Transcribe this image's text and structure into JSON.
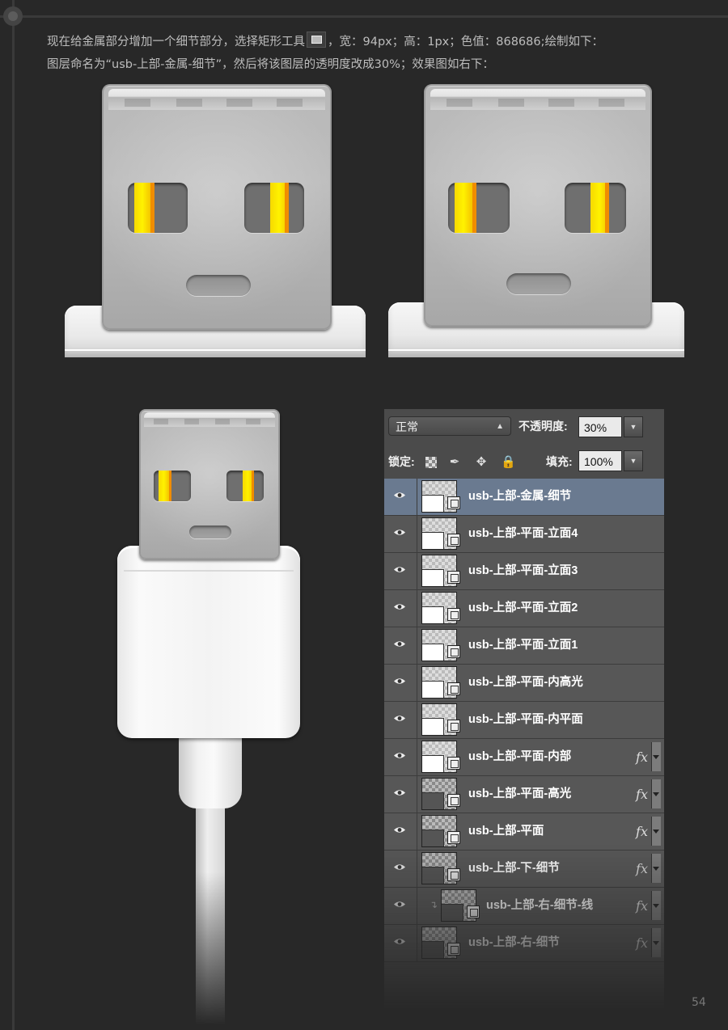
{
  "intro": {
    "line1_a": "现在给金属部分增加一个细节部分，选择矩形工具",
    "line1_b": "，宽：94px；高：1px；色值：868686;绘制如下：",
    "line2": "图层命名为“usb-上部-金属-细节”，然后将该图层的透明度改成30%；效果图如右下："
  },
  "layers_panel": {
    "blend_mode": "正常",
    "opacity_label": "不透明度:",
    "opacity_value": "30%",
    "lock_label": "锁定:",
    "fill_label": "填充:",
    "fill_value": "100%",
    "layers": [
      {
        "name": "usb-上部-金属-细节",
        "selected": true,
        "fx": ""
      },
      {
        "name": "usb-上部-平面-立面4",
        "selected": false,
        "fx": ""
      },
      {
        "name": "usb-上部-平面-立面3",
        "selected": false,
        "fx": ""
      },
      {
        "name": "usb-上部-平面-立面2",
        "selected": false,
        "fx": ""
      },
      {
        "name": "usb-上部-平面-立面1",
        "selected": false,
        "fx": ""
      },
      {
        "name": "usb-上部-平面-内高光",
        "selected": false,
        "fx": ""
      },
      {
        "name": "usb-上部-平面-内平面",
        "selected": false,
        "fx": ""
      },
      {
        "name": "usb-上部-平面-内部",
        "selected": false,
        "fx": "fx"
      },
      {
        "name": "usb-上部-平面-高光",
        "selected": false,
        "fx": "fx"
      },
      {
        "name": "usb-上部-平面",
        "selected": false,
        "fx": "fx"
      },
      {
        "name": "usb-上部-下-细节",
        "selected": false,
        "fx": "fx"
      },
      {
        "name": "usb-上部-右-细节-线",
        "selected": false,
        "fx": "fx",
        "clipped": true
      },
      {
        "name": "usb-上部-右-细节",
        "selected": false,
        "fx": "fx"
      }
    ]
  },
  "page_number": "54",
  "colors": {
    "background": "#282828",
    "selected_layer": "#6a7a90",
    "metal_detail": "#868686"
  }
}
